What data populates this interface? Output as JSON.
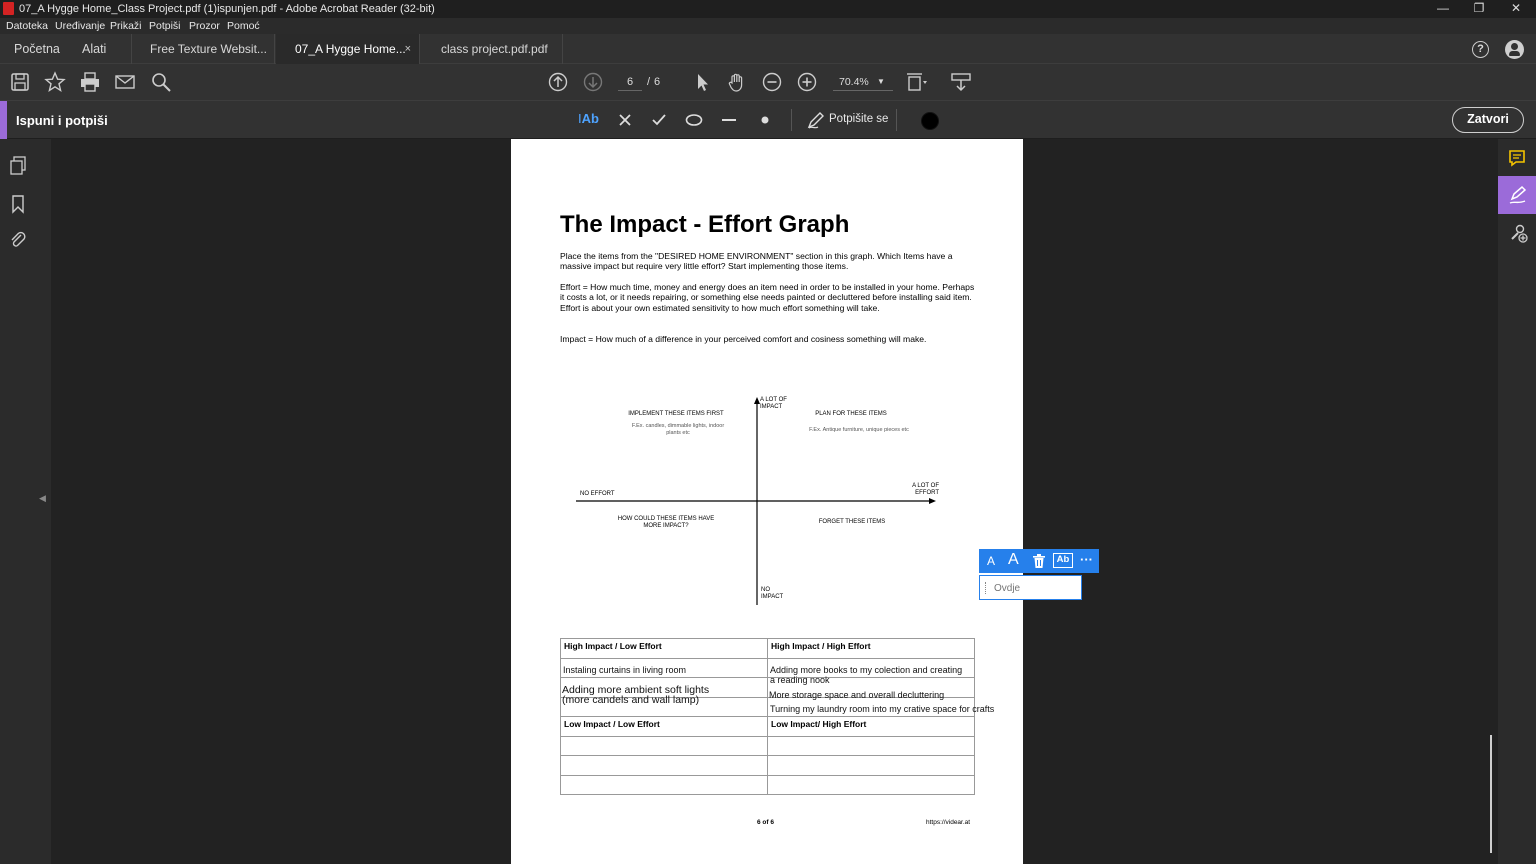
{
  "window": {
    "title": "07_A Hygge Home_Class Project.pdf (1)ispunjen.pdf - Adobe Acrobat Reader (32-bit)",
    "controls": [
      "—",
      "❐",
      "✕"
    ]
  },
  "menu": [
    "Datoteka",
    "Uređivanje",
    "Prikaži",
    "Potpiši",
    "Prozor",
    "Pomoć"
  ],
  "tabs": {
    "home": "Početna",
    "tools": "Alati",
    "docs": [
      "Free Texture Websit...",
      "07_A Hygge Home...",
      "class project.pdf.pdf"
    ],
    "active_index": 1,
    "close_glyph": "×"
  },
  "toolbar": {
    "page_current": "6",
    "page_sep": "/",
    "page_total": "6",
    "zoom": "70.4%"
  },
  "fill_sign": {
    "label": "Ispuni i potpiši",
    "text_tool": "Ab",
    "sign_label": "Potpišite se",
    "close_label": "Zatvori"
  },
  "page": {
    "title": "The Impact - Effort Graph",
    "para1": "Place the items from the \"DESIRED HOME ENVIRONMENT\" section in this graph.  Which Items have a massive impact but require very little effort? Start implementing those items.",
    "para2": "Effort = How much time, money and energy does an item need in order to be installed in your home. Perhaps it costs a lot, or it needs repairing, or something else needs painted or decluttered before installing said item. Effort is about your own estimated sensitivity to how much effort something will take.",
    "para3": "Impact = How much of a difference in your perceived comfort and cosiness something will make.",
    "graph": {
      "top_axis": "A LOT OF IMPACT",
      "bottom_axis": "NO IMPACT",
      "left_axis": "NO EFFORT",
      "right_axis": "A LOT OF EFFORT",
      "q1_title": "IMPLEMENT THESE ITEMS FIRST",
      "q1_sub": "F.Ex. candles, dimmable lights, indoor plants etc",
      "q2_title": "PLAN FOR THESE ITEMS",
      "q2_sub": "F.Ex. Antique furniture, unique pieces etc",
      "q3_title": "HOW COULD THESE ITEMS HAVE MORE IMPACT?",
      "q4_title": "FORGET THESE ITEMS"
    },
    "table": {
      "h1": "High Impact / Low Effort",
      "h2": "High Impact / High Effort",
      "h3": "Low Impact / Low Effort",
      "h4": "Low Impact/ High Effort"
    },
    "filled": {
      "a1": "Instaling curtains in living room",
      "a2_line1": "Adding more ambient soft lights",
      "a2_line2": "(more candels and wall lamp)",
      "b1_line1": "Adding more books to my colection and creating",
      "b1_line2": "a reading nook",
      "b2": "More storage space and overall decluttering",
      "b3": "Turning my laundry room into my crative space for crafts"
    },
    "footer_page": "6 of 6",
    "footer_url": "https://videar.at"
  },
  "text_field": {
    "placeholder": "Ovdje",
    "tool_a_small": "A",
    "tool_a_large": "A",
    "tool_more": "···"
  },
  "colors": {
    "accent_purple": "#9b6bd9",
    "tool_blue": "#2680eb",
    "comment_yellow": "#f5c400"
  }
}
